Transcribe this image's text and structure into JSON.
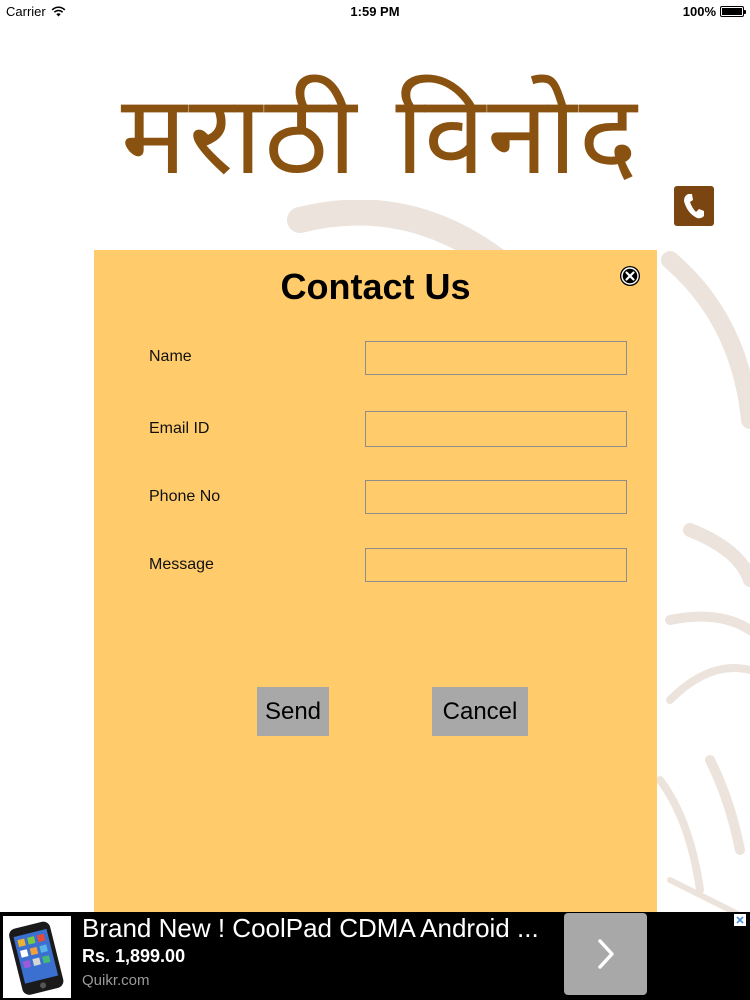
{
  "status_bar": {
    "carrier": "Carrier",
    "time": "1:59 PM",
    "battery": "100%",
    "battery_level": 1.0
  },
  "header": {
    "logo_text": "मराठी विनोद",
    "phone_icon": "phone-icon"
  },
  "contact_form": {
    "title": "Contact Us",
    "close_icon": "close-icon",
    "fields": [
      {
        "label": "Name",
        "value": "",
        "placeholder": ""
      },
      {
        "label": "Email ID",
        "value": "",
        "placeholder": ""
      },
      {
        "label": "Phone No",
        "value": "",
        "placeholder": ""
      },
      {
        "label": "Message",
        "value": "",
        "placeholder": ""
      }
    ],
    "send_label": "Send",
    "cancel_label": "Cancel"
  },
  "ad": {
    "title": "Brand New ! CoolPad CDMA Android ...",
    "price": "Rs. 1,899.00",
    "source": "Quikr.com",
    "arrow_icon": "chevron-right-icon"
  },
  "colors": {
    "logo": "#8a5210",
    "panel": "#ffcb6b",
    "phone_button": "#7a4510",
    "button": "#a8a8a8",
    "ad_background": "#000000"
  }
}
